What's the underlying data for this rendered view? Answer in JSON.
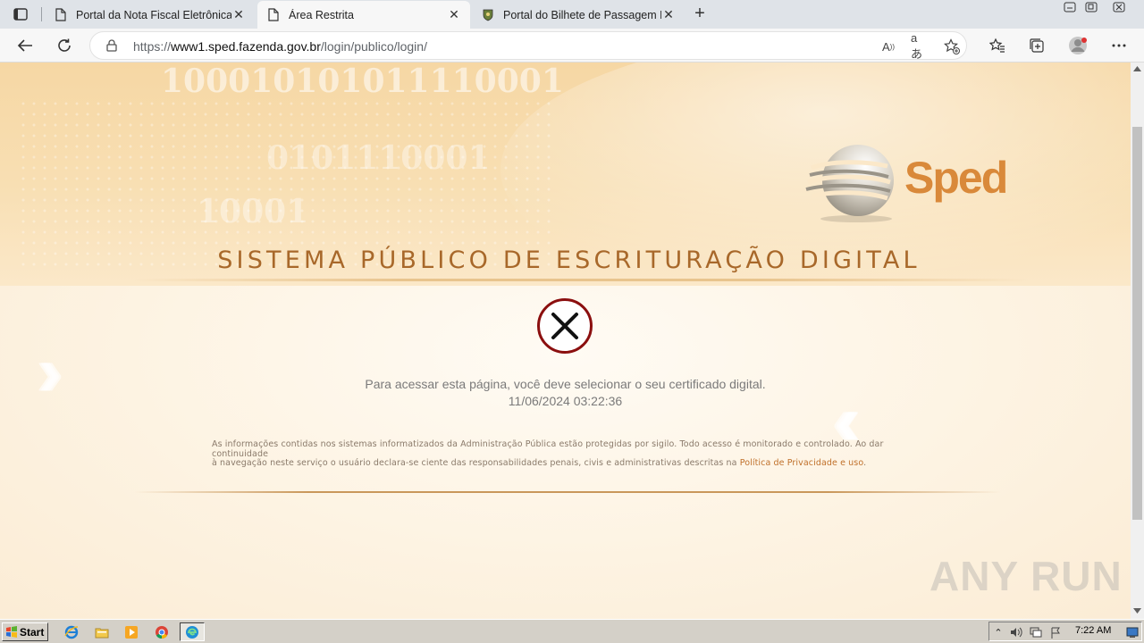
{
  "browser": {
    "tabs": [
      {
        "title": "Portal da Nota Fiscal Eletrônica",
        "active": false
      },
      {
        "title": "Área Restrita",
        "active": true
      },
      {
        "title": "Portal do Bilhete de Passagem Ele",
        "active": false
      }
    ],
    "address": {
      "protocol": "https://",
      "host": "www1.sped.fazenda.gov.br",
      "path": "/login/publico/login/"
    }
  },
  "page": {
    "banner": {
      "binary_1": "100010101011110001",
      "binary_2": "0101110001",
      "binary_3": "10001",
      "logo_text": "Sped",
      "system_title": "SISTEMA PÚBLICO DE ESCRITURAÇÃO DIGITAL"
    },
    "error": {
      "message": "Para acessar esta página, você deve selecionar o seu certificado digital.",
      "timestamp": "11/06/2024 03:22:36"
    },
    "disclaimer": {
      "line1": "As informações contidas nos sistemas informatizados da Administração Pública estão protegidas por sigilo. Todo acesso é monitorado e controlado. Ao dar continuidade",
      "line2_prefix": "à navegação neste serviço o usuário declara-se ciente das responsabilidades penais, civis e administrativas descritas na ",
      "link": "Política de Privacidade e uso",
      "line2_suffix": "."
    },
    "watermark": "ANY RUN"
  },
  "taskbar": {
    "start_label": "Start",
    "clock": "7:22 AM"
  },
  "colors": {
    "accent_orange": "#d9893a",
    "title_brown": "#a8682a",
    "error_red": "#8b0f0f"
  }
}
